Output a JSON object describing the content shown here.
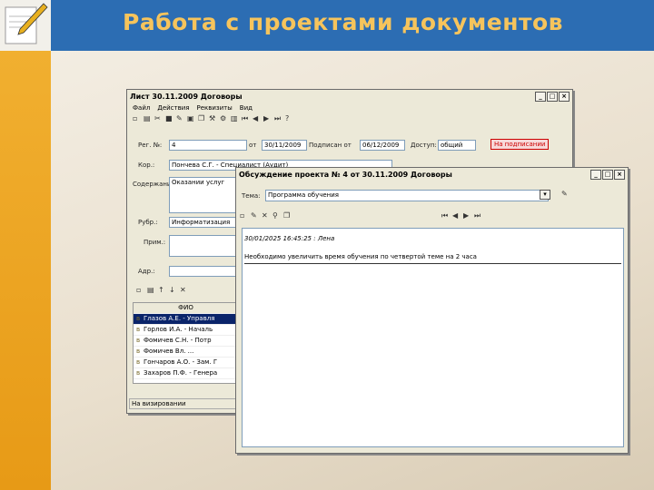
{
  "slide": {
    "title": "Работа с проектами документов"
  },
  "main_window": {
    "title": "Лист 30.11.2009 Договоры",
    "menu": [
      "Файл",
      "Действия",
      "Реквизиты",
      "Вид"
    ],
    "reg_label": "Рег. №:",
    "reg_value": "4",
    "from_label": "от",
    "from_value": "30/11/2009",
    "sign_label": "Подписан от",
    "sign_value": "06/12/2009",
    "access_label": "Доступ:",
    "access_value": "общий",
    "status": "На подписании",
    "kor_label": "Кор.:",
    "kor_value": "Пончева С.Г. - Специалист (Аудит)",
    "content_label": "Содержание:",
    "content_value": "Оказании услуг",
    "rubr_label": "Рубр.:",
    "rubr_value": "Информатизация",
    "note_label": "Прим.:",
    "addr_label": "Адр.:",
    "table_header": "ФИО",
    "rows": [
      "Глазов А.Е. - Управля",
      "Горлов И.А. - Началь",
      "Фомичев С.Н. - Потр",
      "Фомичев Вл. ...",
      "Гончаров А.О. - Зам. Г",
      "Захаров П.Ф. - Генера"
    ],
    "footer_status": "На визировании"
  },
  "discussion_window": {
    "title": "Обсуждение проекта № 4 от 30.11.2009 Договоры",
    "topic_label": "Тема:",
    "topic_value": "Программа обучения",
    "post_header": "30/01/2025 16:45:25 : Лена",
    "post_body": "Необходимо увеличить время обучения по четвертой теме на 2 часа"
  }
}
